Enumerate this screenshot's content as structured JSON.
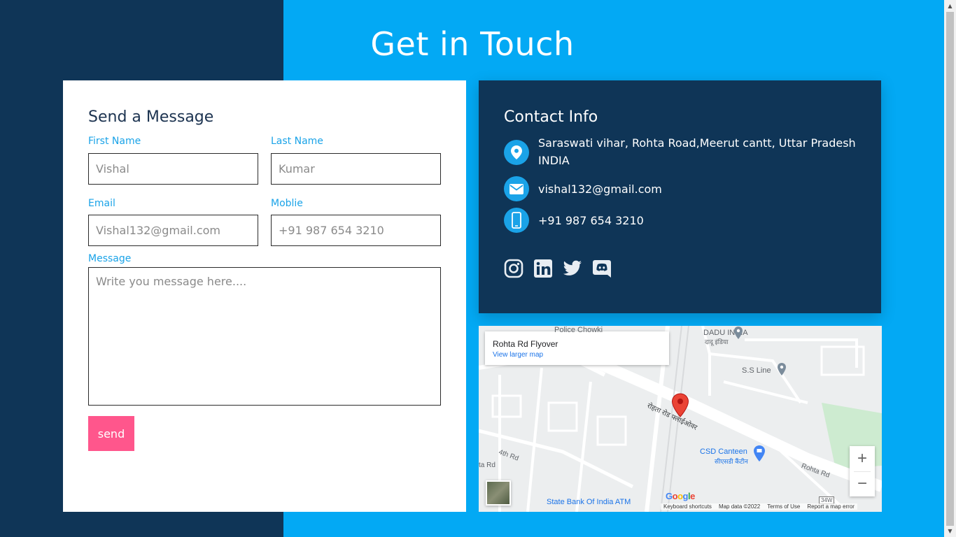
{
  "title": "Get in Touch",
  "form": {
    "heading": "Send a Message",
    "first_name_label": "First Name",
    "first_name_placeholder": "Vishal",
    "last_name_label": "Last Name",
    "last_name_placeholder": "Kumar",
    "email_label": "Email",
    "email_placeholder": "Vishal132@gmail.com",
    "mobile_label": "Moblie",
    "mobile_placeholder": "+91 987 654 3210",
    "message_label": "Message",
    "message_placeholder": "Write you message here....",
    "send_label": "send"
  },
  "contact": {
    "heading": "Contact Info",
    "address": "Saraswati vihar, Rohta Road,Meerut cantt, Uttar Pradesh INDIA",
    "email": "vishal132@gmail.com",
    "phone": "+91 987 654 3210",
    "socials": [
      "instagram-icon",
      "linkedin-icon",
      "twitter-icon",
      "discord-icon"
    ]
  },
  "map": {
    "place_name": "Rohta Rd Flyover",
    "view_larger": "View larger map",
    "labels": {
      "police": "Police Chowki",
      "dadu": "DADU INDIA",
      "dadu_hindi": "दादू इंडिया",
      "ss_line": "S.S Line",
      "flyover_hindi": "रोहता रोड फ्लाईओवर",
      "csd": "CSD Canteen",
      "csd_hindi": "सीएसडी कैंटीन",
      "fourth_rd": "4th Rd",
      "rd": "ta Rd",
      "rohta_rd": "Rohta Rd",
      "sbi": "State Bank Of India ATM",
      "route": "34W"
    },
    "zoom_in": "+",
    "zoom_out": "−",
    "google": "Google",
    "footer": {
      "shortcuts": "Keyboard shortcuts",
      "data": "Map data ©2022",
      "terms": "Terms of Use",
      "report": "Report a map error"
    }
  },
  "colors": {
    "dark": "#0f3557",
    "accent": "#03a9f4",
    "button": "#ff568c",
    "label": "#1aa3e8"
  }
}
